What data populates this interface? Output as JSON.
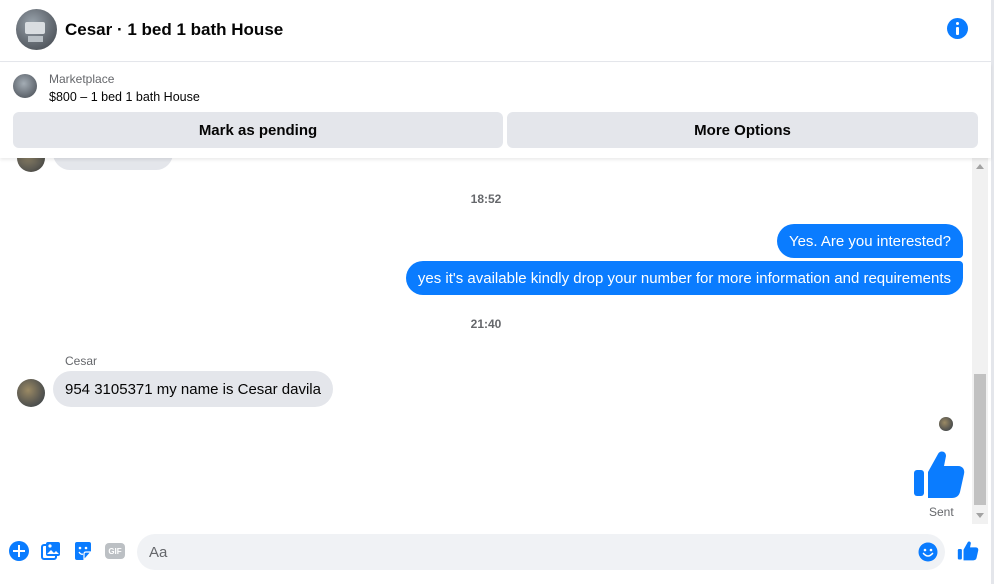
{
  "colors": {
    "accent": "#0a7cff",
    "incoming_bubble": "#e4e6eb",
    "secondary_text": "#65676b"
  },
  "header": {
    "title": "Cesar · 1 bed 1 bath House",
    "info_icon": "info-icon"
  },
  "listing": {
    "source": "Marketplace",
    "title": "$800 – 1 bed 1 bath House",
    "actions": [
      {
        "label": "Mark as pending"
      },
      {
        "label": "More Options"
      }
    ]
  },
  "conversation": {
    "messages": [
      {
        "type": "timestamp",
        "text": "18:52"
      },
      {
        "type": "outgoing",
        "text": "Yes. Are you interested?"
      },
      {
        "type": "outgoing",
        "text": "yes it's available kindly drop your number for more information and requirements"
      },
      {
        "type": "timestamp",
        "text": "21:40"
      },
      {
        "type": "incoming",
        "sender": "Cesar",
        "text": "954 3105371 my name is Cesar davila"
      },
      {
        "type": "outgoing-like",
        "icon": "thumbs-up-icon"
      }
    ],
    "status": "Sent"
  },
  "composer": {
    "placeholder": "Aa",
    "icons": [
      "plus-icon",
      "image-icon",
      "sticker-icon",
      "gif-icon",
      "emoji-icon",
      "like-icon"
    ],
    "gif_label": "GIF"
  }
}
